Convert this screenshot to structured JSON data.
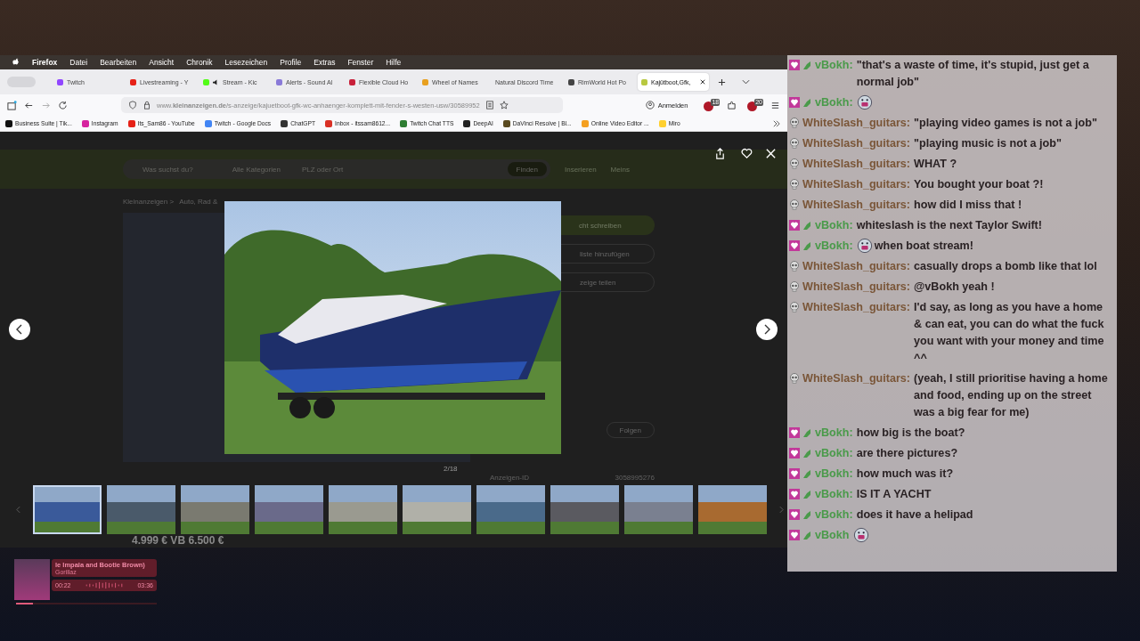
{
  "menu_bar": {
    "app": "Firefox",
    "items": [
      "Datei",
      "Bearbeiten",
      "Ansicht",
      "Chronik",
      "Lesezeichen",
      "Profile",
      "Extras",
      "Fenster",
      "Hilfe"
    ]
  },
  "tabs": [
    {
      "label": "Twitch",
      "selected": false,
      "color": "#9146ff"
    },
    {
      "label": "Livestreaming - Y",
      "selected": false,
      "color": "#e62117"
    },
    {
      "label": "Stream - Kic",
      "selected": false,
      "color": "#53fc18",
      "muted": true
    },
    {
      "label": "Alerts - Sound Al",
      "selected": false,
      "color": "#8a7ad8"
    },
    {
      "label": "Flexible Cloud Ho",
      "selected": false,
      "color": "#c8203a"
    },
    {
      "label": "Wheel of Names",
      "selected": false,
      "color": "#e8a020"
    },
    {
      "label": "Natural Discord Time",
      "selected": false
    },
    {
      "label": "RimWorld Hot Po",
      "selected": false,
      "color": "#444444"
    },
    {
      "label": "Kajütboot,Gfk,",
      "selected": true,
      "color": "#b8c840"
    }
  ],
  "address_bar": {
    "url": "www.**kleinanzeigen.de**/s-anzeige/kajuetboot-gfk-wc-anhaenger-komplett-mit-fender-s-westen-usw/30589952"
  },
  "toolbar": {
    "sign_in": "Anmelden",
    "extension_badges": [
      "18",
      "20"
    ]
  },
  "bookmarks": [
    {
      "label": "Business Suite | Tik...",
      "color": "#111111"
    },
    {
      "label": "Instagram",
      "color": "#d6249f"
    },
    {
      "label": "Its_Sam86 - YouTube",
      "color": "#e62117"
    },
    {
      "label": "Twitch - Google Docs",
      "color": "#4285f4"
    },
    {
      "label": "ChatGPT",
      "color": "#333333"
    },
    {
      "label": "Inbox - itssam8612...",
      "color": "#d93025"
    },
    {
      "label": "Twitch Chat TTS",
      "color": "#2e7d32"
    },
    {
      "label": "DeepAI",
      "color": "#222222"
    },
    {
      "label": "DaVinci Resolve | Bl...",
      "color": "#5a4a20"
    },
    {
      "label": "Online Video Editor ...",
      "color": "#f4a020"
    },
    {
      "label": "Miro",
      "color": "#ffd02f"
    }
  ],
  "page": {
    "search_placeholder": "Was suchst du?",
    "category": "Alle Kategorien",
    "location_placeholder": "PLZ oder Ort",
    "search_button": "Finden",
    "post_link": "Inserieren",
    "account_link": "Meins",
    "breadcrumb": [
      "Kleinanzeigen >",
      "Auto, Rad &"
    ],
    "actions": [
      "cht schreiben",
      "liste hinzufügen",
      "zeige teilen"
    ],
    "follow_button": "Folgen",
    "image_counter": "2/18",
    "ad_id_label": "Anzeigen-ID",
    "ad_id": "3058995276",
    "price": "4.999 € VB 6.500 €"
  },
  "lightbox": {
    "thumbnails": [
      {
        "selected": true,
        "color": "#3a5a9a"
      },
      {
        "selected": false,
        "color": "#4a5a6a"
      },
      {
        "selected": false,
        "color": "#7a7a70"
      },
      {
        "selected": false,
        "color": "#6a6a8a"
      },
      {
        "selected": false,
        "color": "#9a9a90"
      },
      {
        "selected": false,
        "color": "#b0b0a8"
      },
      {
        "selected": false,
        "color": "#4a6a8a"
      },
      {
        "selected": false,
        "color": "#5a5a60"
      },
      {
        "selected": false,
        "color": "#7a8090"
      },
      {
        "selected": false,
        "color": "#a86a30"
      }
    ]
  },
  "chat": [
    {
      "kind": "subscriber",
      "user": "vBokh:",
      "color": "#4a9a4a",
      "text": "\"that's a waste of time, it's stupid, just get a normal job\"",
      "emote": false
    },
    {
      "kind": "subscriber",
      "user": "vBokh:",
      "color": "#4a9a4a",
      "emote": true
    },
    {
      "kind": "viewer",
      "user": "WhiteSlash_guitars:",
      "color": "#7a5638",
      "text": "\"playing video games is not a job\"",
      "emote": false
    },
    {
      "kind": "viewer",
      "user": "WhiteSlash_guitars:",
      "color": "#7a5638",
      "text": "\"playing music is not a job\"",
      "emote": false
    },
    {
      "kind": "viewer",
      "user": "WhiteSlash_guitars:",
      "color": "#7a5638",
      "text": "WHAT ?",
      "emote": false
    },
    {
      "kind": "viewer",
      "user": "WhiteSlash_guitars:",
      "color": "#7a5638",
      "text": "You bought your boat ?!",
      "emote": false
    },
    {
      "kind": "viewer",
      "user": "WhiteSlash_guitars:",
      "color": "#7a5638",
      "text": "how did I miss that !",
      "emote": false
    },
    {
      "kind": "subscriber",
      "user": "vBokh:",
      "color": "#4a9a4a",
      "text": "whiteslash is the next Taylor Swift!",
      "emote": false
    },
    {
      "kind": "subscriber",
      "user": "vBokh:",
      "color": "#4a9a4a",
      "text": "when boat stream!",
      "emote": true
    },
    {
      "kind": "viewer",
      "user": "WhiteSlash_guitars:",
      "color": "#7a5638",
      "text": "casually drops a bomb like that lol",
      "emote": false
    },
    {
      "kind": "viewer",
      "user": "WhiteSlash_guitars:",
      "color": "#7a5638",
      "text": "@vBokh yeah !",
      "emote": false
    },
    {
      "kind": "viewer",
      "user": "WhiteSlash_guitars:",
      "color": "#7a5638",
      "text": "I'd say, as long as you have a home & can eat, you can do what the fuck you want with your money and time ^^",
      "emote": false
    },
    {
      "kind": "viewer",
      "user": "WhiteSlash_guitars:",
      "color": "#7a5638",
      "text": "(yeah, I still prioritise having a home and food, ending up on the street was a big fear for me)",
      "emote": false
    },
    {
      "kind": "subscriber",
      "user": "vBokh:",
      "color": "#4a9a4a",
      "text": "how big is the boat?",
      "emote": false
    },
    {
      "kind": "subscriber",
      "user": "vBokh:",
      "color": "#4a9a4a",
      "text": "are there pictures?",
      "emote": false
    },
    {
      "kind": "subscriber",
      "user": "vBokh:",
      "color": "#4a9a4a",
      "text": "how much was it?",
      "emote": false
    },
    {
      "kind": "subscriber",
      "user": "vBokh:",
      "color": "#4a9a4a",
      "text": "IS IT A YACHT",
      "emote": false
    },
    {
      "kind": "subscriber",
      "user": "vBokh:",
      "color": "#4a9a4a",
      "text": "does it have a helipad",
      "emote": false
    },
    {
      "kind": "subscriber",
      "user": "vBokh",
      "color": "#4a9a4a",
      "emote": true
    }
  ],
  "music_player": {
    "title": "le Impala and Bootie Brown)",
    "artist": "Gorillaz",
    "elapsed": "00:22",
    "duration": "03:36",
    "level": 0.12
  }
}
